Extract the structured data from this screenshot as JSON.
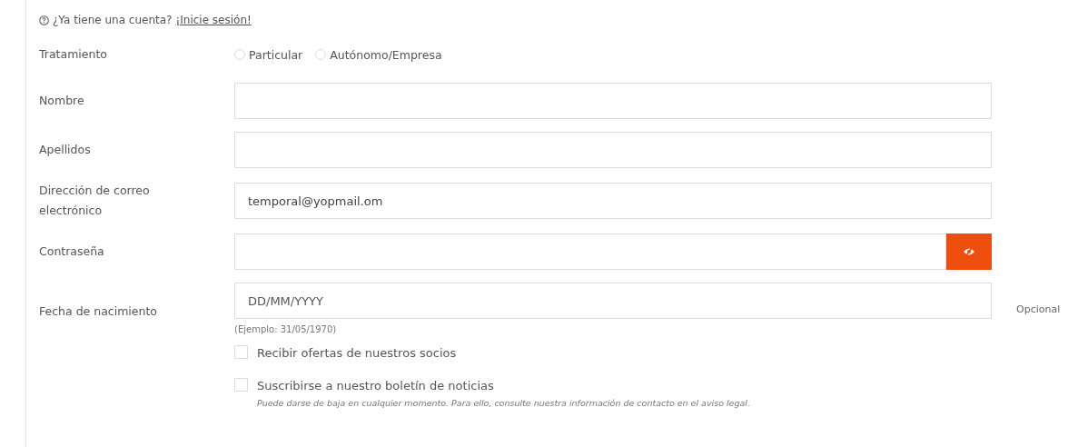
{
  "login_prompt": {
    "text": "¿Ya tiene una cuenta?",
    "link": "¡Inicie sesión!"
  },
  "fields": [
    {
      "kind": "radio",
      "label": "Tratamiento",
      "options": [
        {
          "label": "Particular",
          "selected": false
        },
        {
          "label": "Autónomo/Empresa",
          "selected": false
        }
      ]
    },
    {
      "kind": "text",
      "label": "Nombre"
    },
    {
      "kind": "text",
      "label": "Apellidos"
    },
    {
      "kind": "text",
      "label": "Dirección de correo electrónico",
      "value": "temporal@yopmail.om"
    },
    {
      "kind": "password",
      "label": "Contraseña"
    },
    {
      "kind": "date",
      "label": "Fecha de nacimiento",
      "placeholder": "DD/MM/YYYY",
      "hint": "(Ejemplo: 31/05/1970)",
      "note": "Opcional"
    }
  ],
  "checkboxes": [
    {
      "label": "Recibir ofertas de nuestros socios",
      "checked": false
    },
    {
      "label": "Suscribirse a nuestro boletín de noticias",
      "checked": false,
      "note": "Puede darse de baja en cualquier momento. Para ello, consulte nuestra información de contacto en el aviso legal."
    }
  ]
}
